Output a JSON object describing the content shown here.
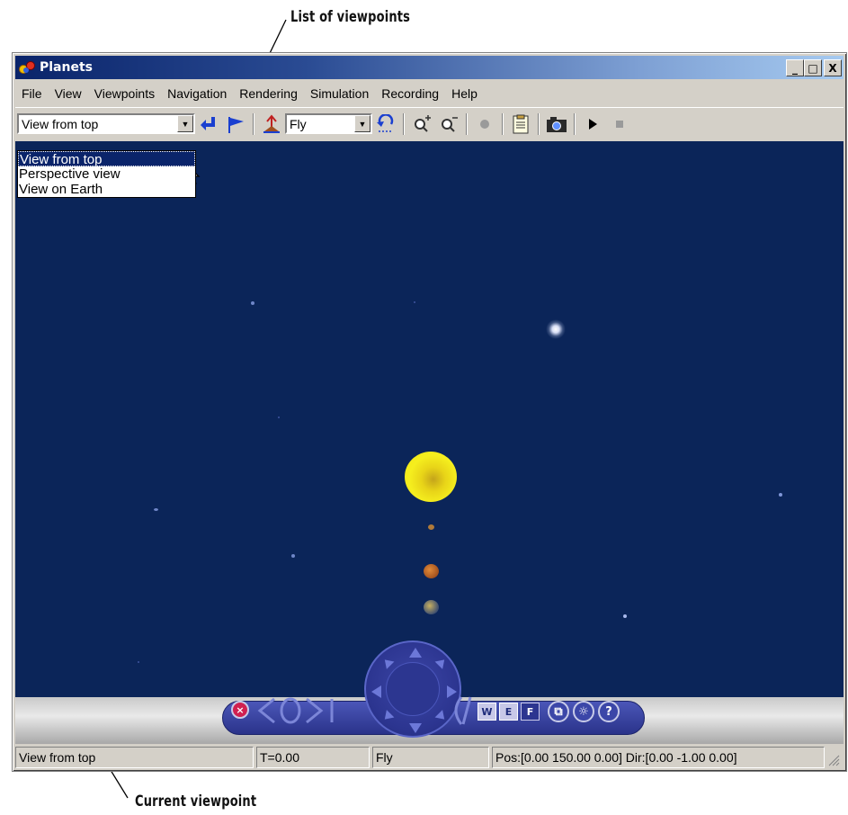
{
  "callouts": {
    "top": "List of viewpoints",
    "bottom": "Current viewpoint"
  },
  "window": {
    "title": "Planets",
    "controls": {
      "minimize": "_",
      "maximize": "□",
      "close": "X"
    }
  },
  "menu": [
    "File",
    "View",
    "Viewpoints",
    "Navigation",
    "Rendering",
    "Simulation",
    "Recording",
    "Help"
  ],
  "toolbar": {
    "viewpoint_value": "View from top",
    "nav_mode_value": "Fly",
    "icons": [
      "return-arrow-icon",
      "flag-icon",
      "straighten-up-icon",
      "undo-move-icon",
      "zoom-in-icon",
      "zoom-out-icon",
      "headlight-icon",
      "block-icon",
      "capture-icon",
      "play-icon",
      "stop-icon"
    ]
  },
  "viewpoint_list": [
    "View from top",
    "Perspective view",
    "View on Earth"
  ],
  "nav_panel": {
    "buttons": [
      "W",
      "E",
      "F"
    ],
    "round_help": "?"
  },
  "status": {
    "viewpoint": "View from top",
    "time": "T=0.00",
    "mode": "Fly",
    "position": "Pos:[0.00 150.00 0.00] Dir:[0.00 -1.00 0.00]"
  },
  "colors": {
    "scene_background": "#0b2559",
    "sun": "#f2e612",
    "title_bar": "#0a246a"
  }
}
